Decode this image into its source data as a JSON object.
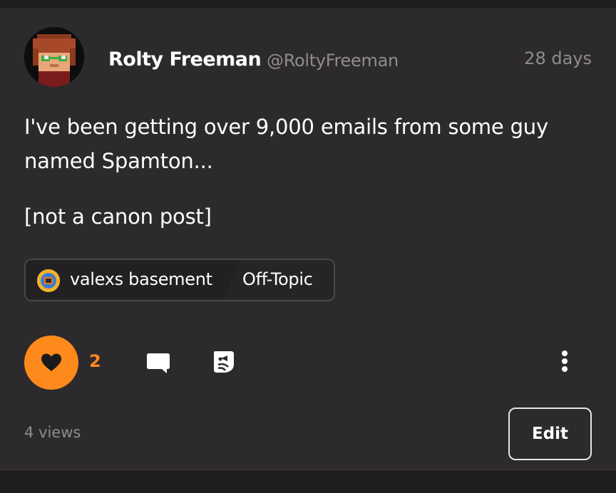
{
  "post": {
    "author_name": "Rolty Freeman",
    "author_handle": "@RoltyFreeman",
    "timestamp": "28 days",
    "body_lines": [
      "I've been getting over 9,000 emails from some guy",
      "named Spamton...",
      "[not a canon post]"
    ]
  },
  "tags": {
    "community": "valexs basement",
    "category": "Off-Topic"
  },
  "actions": {
    "like_count": "2",
    "like_icon": "heart-icon",
    "comment_icon": "comment-icon",
    "share_icon": "share-icon",
    "more_icon": "more-vertical-icon"
  },
  "footer": {
    "views": "4 views",
    "edit_label": "Edit"
  },
  "colors": {
    "accent": "#ff8a1c",
    "card_background": "#2d2a2d",
    "page_background": "#1f1d20",
    "muted_text": "#8f8c8f"
  }
}
